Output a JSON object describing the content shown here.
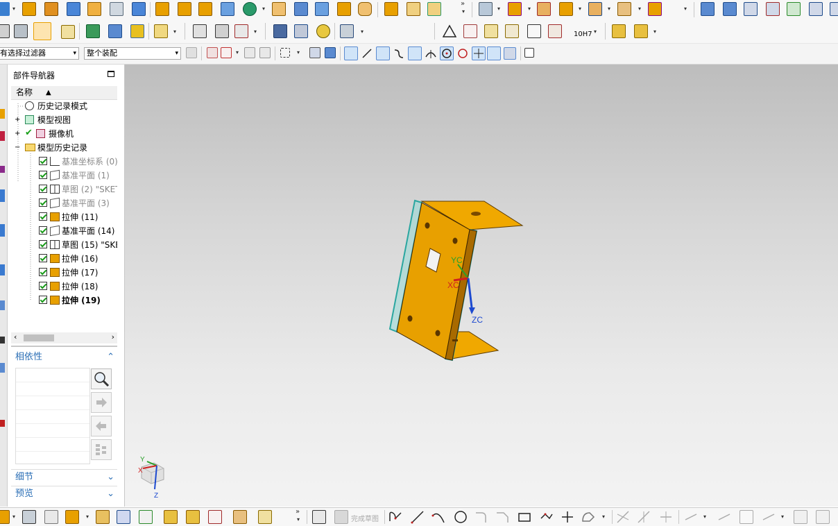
{
  "toolbar": {
    "selection_filter": "有选择过滤器",
    "assembly_scope": "整个装配",
    "tolerance_label": "10H7",
    "finish_sketch_label": "完成草图"
  },
  "navigator": {
    "title": "部件导航器",
    "column_name": "名称",
    "items": [
      {
        "label": "历史记录模式"
      },
      {
        "label": "模型视图"
      },
      {
        "label": "摄像机"
      },
      {
        "label": "模型历史记录"
      },
      {
        "label": "基准坐标系 (0)"
      },
      {
        "label": "基准平面 (1)"
      },
      {
        "label": "草图 (2) \"SKET"
      },
      {
        "label": "基准平面 (3)"
      },
      {
        "label": "拉伸 (11)"
      },
      {
        "label": "基准平面 (14)"
      },
      {
        "label": "草图 (15) \"SKE"
      },
      {
        "label": "拉伸 (16)"
      },
      {
        "label": "拉伸 (17)"
      },
      {
        "label": "拉伸 (18)"
      },
      {
        "label": "拉伸 (19)"
      }
    ],
    "dependency_title": "相依性",
    "details_title": "细节",
    "preview_title": "预览"
  },
  "viewport": {
    "axis_labels": {
      "yc": "YC",
      "xc": "XC",
      "zc": "ZC"
    },
    "triad_labels": {
      "y": "Y",
      "x": "X",
      "z": "Z"
    },
    "colors": {
      "part": "#e8a000",
      "part_dark": "#a86a00",
      "datum": "#2aa6a0"
    }
  }
}
